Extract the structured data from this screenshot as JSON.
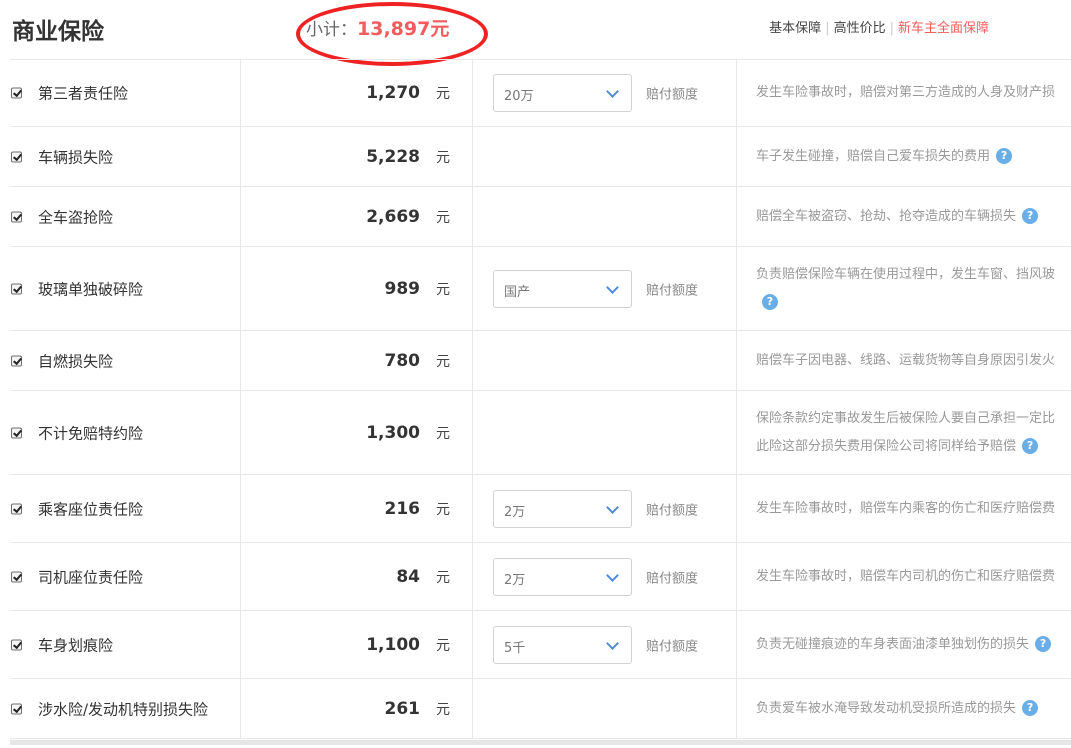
{
  "header": {
    "title": "商业保险",
    "subtotal_label": "小计：",
    "subtotal_value": "13,897元",
    "plans": [
      {
        "label": "基本保障",
        "active": false
      },
      {
        "label": "高性价比",
        "active": false
      },
      {
        "label": "新车主全面保障",
        "active": true
      }
    ]
  },
  "icons": {
    "checkbox": "checkbox-checked-icon",
    "help": "question-mark-icon",
    "dropdown": "chevron-down-icon"
  },
  "colors": {
    "accent": "#f25c5c",
    "annotation": "#ee2222",
    "help_icon": "#6aaee8"
  },
  "rows": [
    {
      "name": "第三者责任险",
      "price": "1,270",
      "unit": "元",
      "select": "20万",
      "select_label": "赔付额度",
      "desc": [
        "发生车险事故时，赔偿对第三方造成的人身及财产损"
      ],
      "help": false
    },
    {
      "name": "车辆损失险",
      "price": "5,228",
      "unit": "元",
      "desc": [
        "车子发生碰撞，赔偿自己爱车损失的费用"
      ],
      "help": true
    },
    {
      "name": "全车盗抢险",
      "price": "2,669",
      "unit": "元",
      "desc": [
        "赔偿全车被盗窃、抢劫、抢夺造成的车辆损失"
      ],
      "help": true
    },
    {
      "name": "玻璃单独破碎险",
      "price": "989",
      "unit": "元",
      "select": "国产",
      "select_label": "赔付额度",
      "desc": [
        "负责赔偿保险车辆在使用过程中，发生车窗、挡风玻",
        ""
      ],
      "help": true
    },
    {
      "name": "自燃损失险",
      "price": "780",
      "unit": "元",
      "desc": [
        "赔偿车子因电器、线路、运载货物等自身原因引发火"
      ],
      "help": false
    },
    {
      "name": "不计免赔特约险",
      "price": "1,300",
      "unit": "元",
      "desc": [
        "保险条款约定事故发生后被保险人要自己承担一定比",
        "此险这部分损失费用保险公司将同样给予赔偿"
      ],
      "help": true
    },
    {
      "name": "乘客座位责任险",
      "price": "216",
      "unit": "元",
      "select": "2万",
      "select_label": "赔付额度",
      "desc": [
        "发生车险事故时，赔偿车内乘客的伤亡和医疗赔偿费"
      ],
      "help": false
    },
    {
      "name": "司机座位责任险",
      "price": "84",
      "unit": "元",
      "select": "2万",
      "select_label": "赔付额度",
      "desc": [
        "发生车险事故时，赔偿车内司机的伤亡和医疗赔偿费"
      ],
      "help": false
    },
    {
      "name": "车身划痕险",
      "price": "1,100",
      "unit": "元",
      "select": "5千",
      "select_label": "赔付额度",
      "desc": [
        "负责无碰撞痕迹的车身表面油漆单独划伤的损失"
      ],
      "help": true
    },
    {
      "name": "涉水险/发动机特别损失险",
      "price": "261",
      "unit": "元",
      "desc": [
        "负责爱车被水淹导致发动机受损所造成的损失"
      ],
      "help": true
    }
  ]
}
